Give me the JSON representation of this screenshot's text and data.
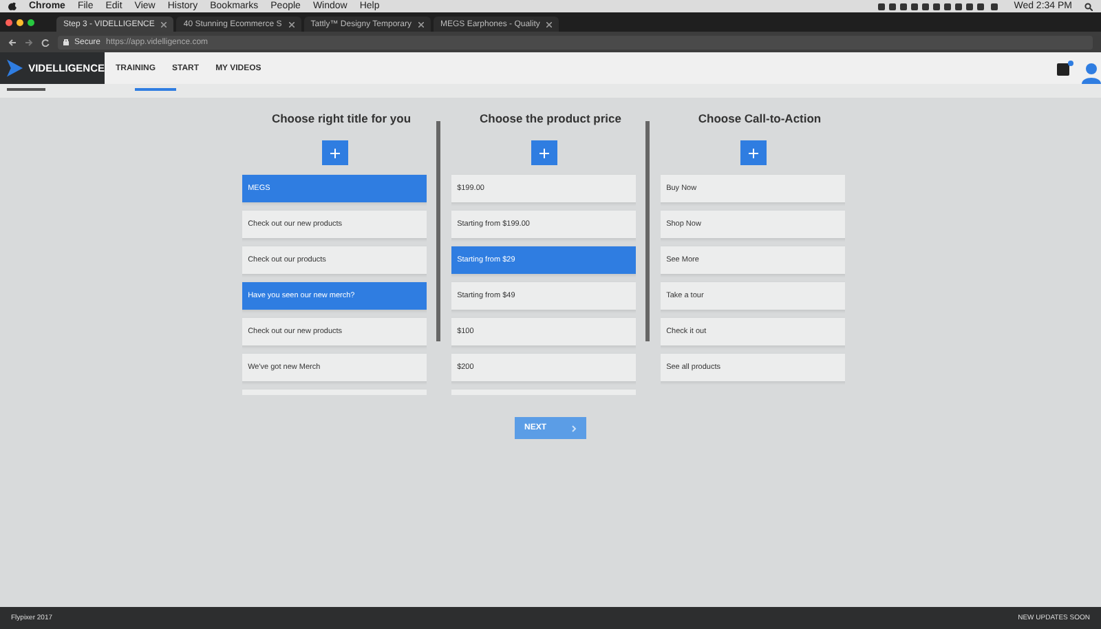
{
  "menu_bar": {
    "items": [
      "Chrome",
      "File",
      "Edit",
      "View",
      "History",
      "Bookmarks",
      "People",
      "Window",
      "Help"
    ],
    "clock": "Wed 2:34 PM"
  },
  "browser_tabs": [
    {
      "label": "Step 3 - VIDELLIGENCE",
      "selected": true
    },
    {
      "label": "40 Stunning Ecommerce S",
      "selected": false
    },
    {
      "label": "Tattly™ Designy Temporary",
      "selected": false
    },
    {
      "label": "MEGS Earphones - Quality",
      "selected": false
    }
  ],
  "address_bar": {
    "secure": "Secure",
    "url": "https://app.videlligence.com"
  },
  "app_header": {
    "logo": "VIDELLIGENCE",
    "nav": [
      "TRAINING",
      "START",
      "MY VIDEOS"
    ]
  },
  "columns": [
    {
      "title": "Choose right title for you",
      "scrollable": true,
      "options": [
        {
          "label": "MEGS",
          "selected": true
        },
        {
          "label": "Check out our new products",
          "selected": false
        },
        {
          "label": "Check out our products",
          "selected": false
        },
        {
          "label": "Have you seen our new merch?",
          "selected": true
        },
        {
          "label": "Check out our new products",
          "selected": false
        },
        {
          "label": "We've got new Merch",
          "selected": false
        },
        {
          "selected": false
        }
      ]
    },
    {
      "title": "Choose the product price",
      "scrollable": true,
      "options": [
        {
          "label": "$199.00",
          "selected": false
        },
        {
          "label": "Starting from $199.00",
          "selected": false
        },
        {
          "label": "Starting from $29",
          "selected": true
        },
        {
          "label": "Starting from $49",
          "selected": false
        },
        {
          "label": "$100",
          "selected": false
        },
        {
          "label": "$200",
          "selected": false
        },
        {
          "selected": false
        }
      ]
    },
    {
      "title": "Choose Call-to-Action",
      "scrollable": false,
      "options": [
        {
          "label": "Buy Now",
          "selected": false
        },
        {
          "label": "Shop Now",
          "selected": false
        },
        {
          "label": "See More",
          "selected": false
        },
        {
          "label": "Take a tour",
          "selected": false
        },
        {
          "label": "Check it out",
          "selected": false
        },
        {
          "label": "See all products",
          "selected": false
        }
      ]
    }
  ],
  "next_button": {
    "label": "NEXT"
  },
  "footer": {
    "left": "Flypixer 2017",
    "right": "NEW UPDATES SOON"
  }
}
